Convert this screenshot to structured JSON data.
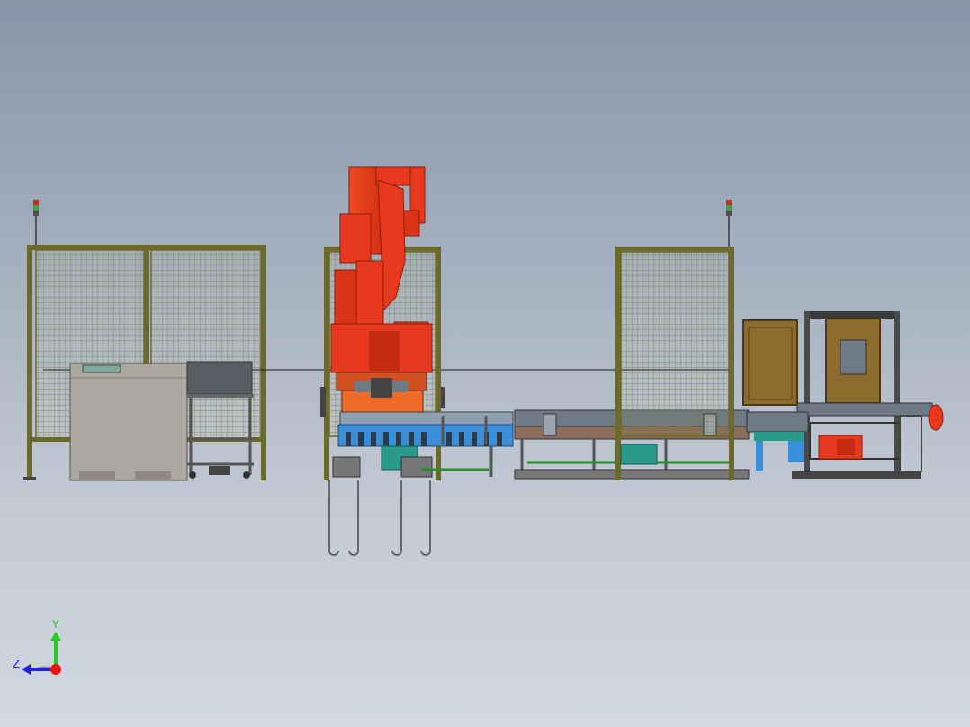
{
  "view": {
    "name": "cad-assembly-front-view",
    "background_top": "#8795a8",
    "background_bottom": "#d2d8df"
  },
  "triad": {
    "y_label": "Y",
    "z_label": "Z",
    "y_color": "#22cc22",
    "z_color": "#2222ee",
    "x_color": "#ee1111"
  },
  "colors": {
    "fence_frame": "#6b6a2a",
    "fence_mesh": "#8c8a4a",
    "robot": "#e8391f",
    "robot_shade": "#b82a12",
    "conveyor_blue": "#3a8fd8",
    "conveyor_teal": "#2a9a8a",
    "cabinet": "#aca89e",
    "wood_box": "#8b6b2e",
    "dark_panel": "#5a5e64",
    "steel": "#6e7a86"
  },
  "components": [
    {
      "name": "safety-fence-left",
      "icon": "mesh-fence-panel"
    },
    {
      "name": "safety-fence-center",
      "icon": "mesh-fence-panel"
    },
    {
      "name": "safety-fence-right",
      "icon": "mesh-fence-panel"
    },
    {
      "name": "signal-tower-left",
      "icon": "signal-light-stack"
    },
    {
      "name": "signal-tower-right",
      "icon": "signal-light-stack"
    },
    {
      "name": "control-cabinet",
      "icon": "cabinet"
    },
    {
      "name": "teach-pendant-cart",
      "icon": "cart"
    },
    {
      "name": "industrial-robot",
      "icon": "robot-arm"
    },
    {
      "name": "gripper-conveyor",
      "icon": "roller-conveyor"
    },
    {
      "name": "transfer-conveyor",
      "icon": "belt-conveyor"
    },
    {
      "name": "pallet-box",
      "icon": "wooden-crate"
    },
    {
      "name": "lift-station",
      "icon": "lift-frame"
    },
    {
      "name": "motor-unit",
      "icon": "motor"
    }
  ]
}
